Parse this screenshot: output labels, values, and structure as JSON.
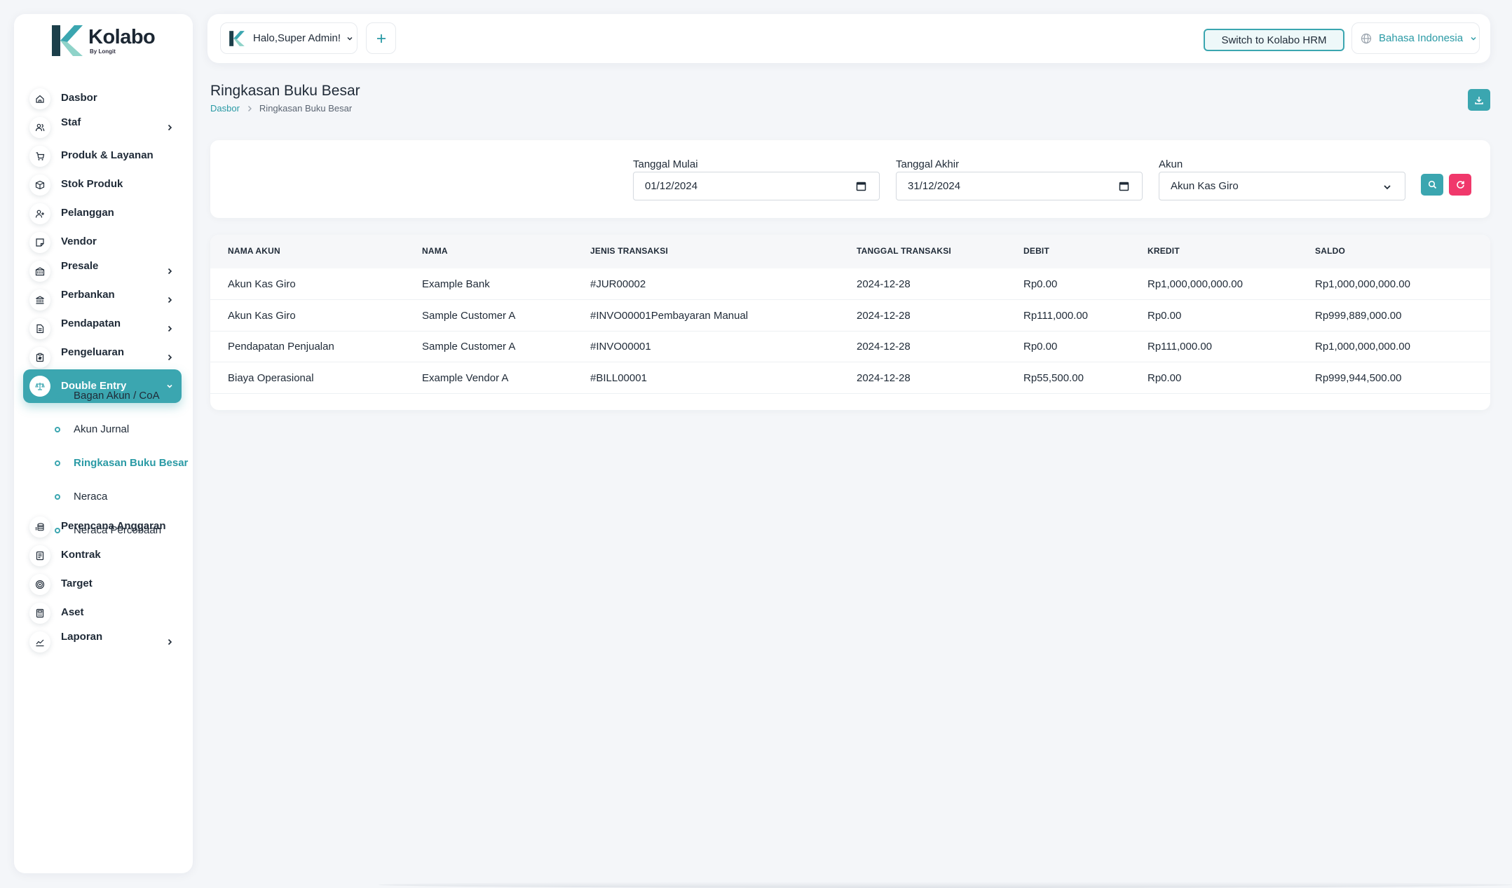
{
  "app": {
    "brand": "Kolabo",
    "brand_sub": "By Longit"
  },
  "colors": {
    "accent": "#3ba6b0",
    "danger": "#f0386b",
    "background": "#f4f6f9"
  },
  "sidebar": {
    "items": [
      {
        "label": "Dasbor",
        "icon": "home-icon",
        "has_children": false
      },
      {
        "label": "Staf",
        "icon": "users-icon",
        "has_children": true
      },
      {
        "label": "Produk & Layanan",
        "icon": "cart-icon",
        "has_children": false
      },
      {
        "label": "Stok Produk",
        "icon": "box-icon",
        "has_children": false
      },
      {
        "label": "Pelanggan",
        "icon": "user-plus-icon",
        "has_children": false
      },
      {
        "label": "Vendor",
        "icon": "note-icon",
        "has_children": false
      },
      {
        "label": "Presale",
        "icon": "building-icon",
        "has_children": true
      },
      {
        "label": "Perbankan",
        "icon": "bank-icon",
        "has_children": true
      },
      {
        "label": "Pendapatan",
        "icon": "file-icon",
        "has_children": true
      },
      {
        "label": "Pengeluaran",
        "icon": "clipboard-icon",
        "has_children": true
      },
      {
        "label": "Double Entry",
        "icon": "scale-icon",
        "has_children": true,
        "expanded": true
      },
      {
        "label": "Perencana Anggaran",
        "icon": "coins-icon",
        "has_children": false
      },
      {
        "label": "Kontrak",
        "icon": "contract-icon",
        "has_children": false
      },
      {
        "label": "Target",
        "icon": "target-icon",
        "has_children": false
      },
      {
        "label": "Aset",
        "icon": "calculator-icon",
        "has_children": false
      },
      {
        "label": "Laporan",
        "icon": "chart-icon",
        "has_children": true
      }
    ],
    "double_entry_children": [
      {
        "label": "Bagan Akun / CoA"
      },
      {
        "label": "Akun Jurnal"
      },
      {
        "label": "Ringkasan Buku Besar",
        "current": true
      },
      {
        "label": "Neraca"
      },
      {
        "label": "Neraca Percobaan"
      }
    ]
  },
  "topbar": {
    "greeting": "Halo,Super Admin!",
    "switch_label": "Switch to Kolabo HRM",
    "language": "Bahasa Indonesia"
  },
  "page": {
    "title": "Ringkasan Buku Besar",
    "breadcrumb_home": "Dasbor",
    "breadcrumb_current": "Ringkasan Buku Besar"
  },
  "filters": {
    "start_label": "Tanggal Mulai",
    "start_value": "01/12/2024",
    "end_label": "Tanggal Akhir",
    "end_value": "31/12/2024",
    "account_label": "Akun",
    "account_value": "Akun Kas Giro"
  },
  "table": {
    "headers": [
      "NAMA AKUN",
      "NAMA",
      "JENIS TRANSAKSI",
      "TANGGAL TRANSAKSI",
      "DEBIT",
      "KREDIT",
      "SALDO"
    ],
    "rows": [
      [
        "Akun Kas Giro",
        "Example Bank",
        "#JUR00002",
        "2024-12-28",
        "Rp0.00",
        "Rp1,000,000,000.00",
        "Rp1,000,000,000.00"
      ],
      [
        "Akun Kas Giro",
        "Sample Customer A",
        "#INVO00001Pembayaran Manual",
        "2024-12-28",
        "Rp111,000.00",
        "Rp0.00",
        "Rp999,889,000.00"
      ],
      [
        "Pendapatan Penjualan",
        "Sample Customer A",
        "#INVO00001",
        "2024-12-28",
        "Rp0.00",
        "Rp111,000.00",
        "Rp1,000,000,000.00"
      ],
      [
        "Biaya Operasional",
        "Example Vendor A",
        "#BILL00001",
        "2024-12-28",
        "Rp55,500.00",
        "Rp0.00",
        "Rp999,944,500.00"
      ]
    ]
  }
}
